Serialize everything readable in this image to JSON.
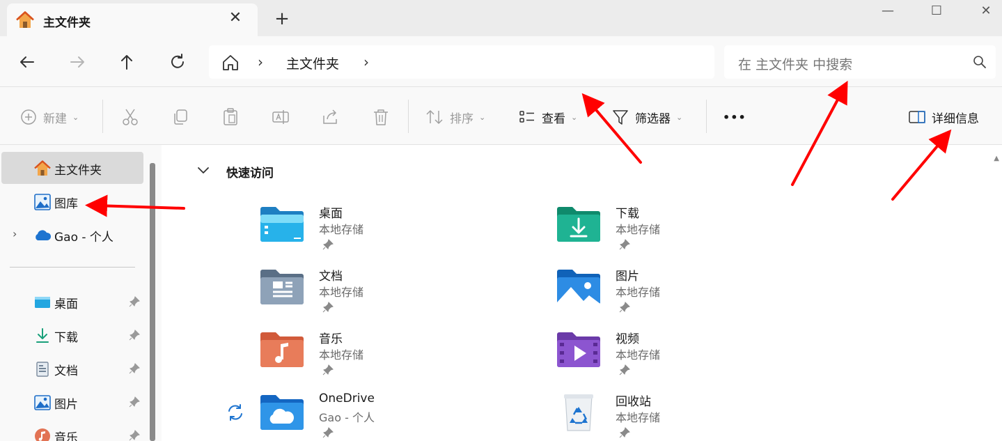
{
  "titlebar": {
    "tab_title": "主文件夹",
    "tab_close": "✕",
    "new_tab": "+",
    "minimize": "—",
    "maximize": "☐",
    "close": "✕"
  },
  "navbar": {
    "address_segment": "主文件夹",
    "search_placeholder": "在 主文件夹 中搜索"
  },
  "commands": {
    "new_label": "新建",
    "sort_label": "排序",
    "view_label": "查看",
    "filter_label": "筛选器",
    "more_label": "•••",
    "details_label": "详细信息"
  },
  "sidebar": {
    "items": [
      {
        "label": "主文件夹"
      },
      {
        "label": "图库"
      },
      {
        "label": "Gao - 个人"
      }
    ],
    "pinned": [
      {
        "label": "桌面"
      },
      {
        "label": "下载"
      },
      {
        "label": "文档"
      },
      {
        "label": "图片"
      },
      {
        "label": "音乐"
      }
    ]
  },
  "main": {
    "section_title": "快速访问",
    "quick_access": [
      {
        "name": "桌面",
        "sub": "本地存储",
        "icon": "desktop-folder-icon"
      },
      {
        "name": "下载",
        "sub": "本地存储",
        "icon": "downloads-folder-icon"
      },
      {
        "name": "文档",
        "sub": "本地存储",
        "icon": "documents-folder-icon"
      },
      {
        "name": "图片",
        "sub": "本地存储",
        "icon": "pictures-folder-icon"
      },
      {
        "name": "音乐",
        "sub": "本地存储",
        "icon": "music-folder-icon"
      },
      {
        "name": "视频",
        "sub": "本地存储",
        "icon": "videos-folder-icon"
      },
      {
        "name": "OneDrive",
        "sub": "Gao - 个人",
        "icon": "onedrive-folder-icon"
      },
      {
        "name": "回收站",
        "sub": "本地存储",
        "icon": "recycle-bin-icon"
      }
    ]
  },
  "colors": {
    "annotation_arrow": "#ff0000",
    "folder_blue": "#1e8fe0",
    "folder_teal": "#1aa58a",
    "home_orange": "#f08a24"
  }
}
